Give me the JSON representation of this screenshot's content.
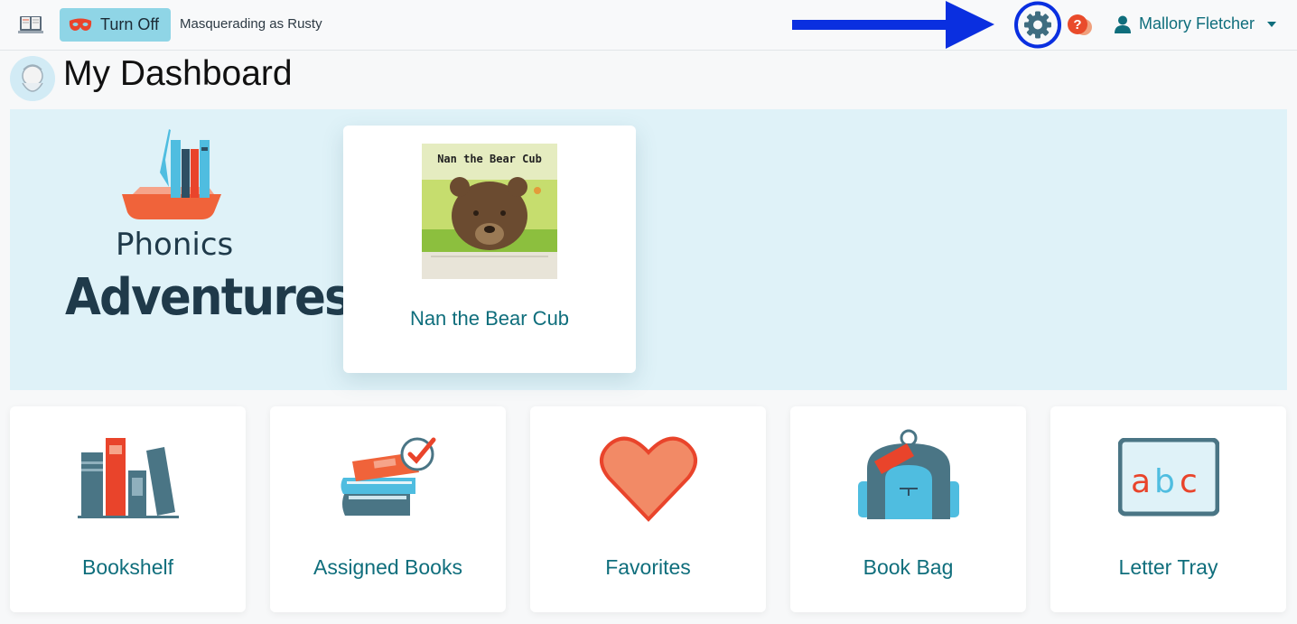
{
  "topbar": {
    "turn_off_label": "Turn Off",
    "masquerade_text": "Masquerading as Rusty",
    "user_name": "Mallory Fletcher"
  },
  "page": {
    "title": "My Dashboard"
  },
  "hero": {
    "logo_line1": "Phonics",
    "logo_line2": "Adventures",
    "book": {
      "cover_title": "Nan the Bear Cub",
      "title": "Nan the Bear Cub"
    }
  },
  "tiles": [
    {
      "label": "Bookshelf",
      "icon": "bookshelf-icon"
    },
    {
      "label": "Assigned Books",
      "icon": "assigned-books-icon"
    },
    {
      "label": "Favorites",
      "icon": "heart-icon"
    },
    {
      "label": "Book Bag",
      "icon": "backpack-icon"
    },
    {
      "label": "Letter Tray",
      "icon": "abc-icon"
    }
  ],
  "colors": {
    "accent": "#0f6e7c",
    "hero_bg": "#dff2f8",
    "turn_off_bg": "#8fd5e6",
    "annotation_arrow": "#0a2fe0",
    "orange": "#f06a3a"
  }
}
